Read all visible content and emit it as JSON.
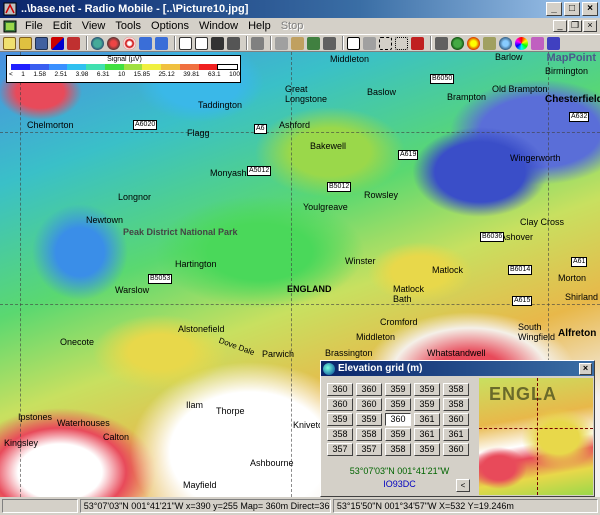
{
  "window": {
    "title": "..\\base.net - Radio Mobile - [..\\Picture10.jpg]"
  },
  "menu": [
    "File",
    "Edit",
    "View",
    "Tools",
    "Options",
    "Window",
    "Help",
    "Stop"
  ],
  "legend": {
    "title": "Signal (µV)",
    "ticks": [
      "<",
      "1",
      "1.58",
      "2.51",
      "3.98",
      "6.31",
      "10",
      "15.85",
      "25.12",
      "39.81",
      "63.1",
      "100"
    ],
    "colors": [
      "#2020ff",
      "#3a5ef0",
      "#3a90ff",
      "#30c0f0",
      "#40e0b0",
      "#40e040",
      "#a0e040",
      "#f0f040",
      "#f0c040",
      "#f07040",
      "#f02020",
      "#ffffff"
    ]
  },
  "map": {
    "watermark": "MapPoint",
    "places": [
      "Middleton",
      "Barlow",
      "Birmington",
      "Taddington",
      "Great Longstone",
      "Baslow",
      "Old Brampton",
      "Brampton",
      "Chesterfield",
      "Chelmorton",
      "Flagg",
      "Ashford",
      "Bakewell",
      "Wingerworth",
      "Longnor",
      "Monyash",
      "Rowsley",
      "Newtown",
      "Youlgreave",
      "Clay Cross",
      "Peak District National Park",
      "Ashover",
      "Hartington",
      "Winster",
      "Matlock",
      "Morton",
      "Warslow",
      "ENGLAND",
      "Matlock Bath",
      "Shirland",
      "Cromford",
      "South Wingfield",
      "Alfreton",
      "Onecote",
      "Alstonefield",
      "Middleton",
      "Brassington",
      "Whatstandwell",
      "Dove Dale",
      "Parwich",
      "Ilam",
      "Thorpe",
      "Ipstones",
      "Waterhouses",
      "Calton",
      "Kniveton",
      "Ashbourne",
      "Kingsley",
      "Mayfield"
    ],
    "roads": [
      "B6050",
      "A6020",
      "A6",
      "A632",
      "A619",
      "B5012",
      "B6014",
      "A61",
      "B5053",
      "A615",
      "A5012",
      "B6036"
    ]
  },
  "elevation": {
    "title": "Elevation grid (m)",
    "grid": [
      [
        "360",
        "360",
        "359",
        "359",
        "358"
      ],
      [
        "360",
        "360",
        "359",
        "359",
        "358"
      ],
      [
        "359",
        "359",
        "360",
        "361",
        "360"
      ],
      [
        "358",
        "358",
        "359",
        "361",
        "361"
      ],
      [
        "357",
        "357",
        "358",
        "359",
        "360"
      ]
    ],
    "coords": "53°07'03\"N  001°41'21\"W",
    "locator": "IO93DC",
    "back_button": "<",
    "preview_label": "ENGLA"
  },
  "status": {
    "position": "53°07'03\"N  001°41'21\"W   x=390 y=255 Map= 360m Direct=360.88m",
    "map_info": "53°15'50\"N 001°34'57\"W  X=532 Y=19.246m"
  }
}
